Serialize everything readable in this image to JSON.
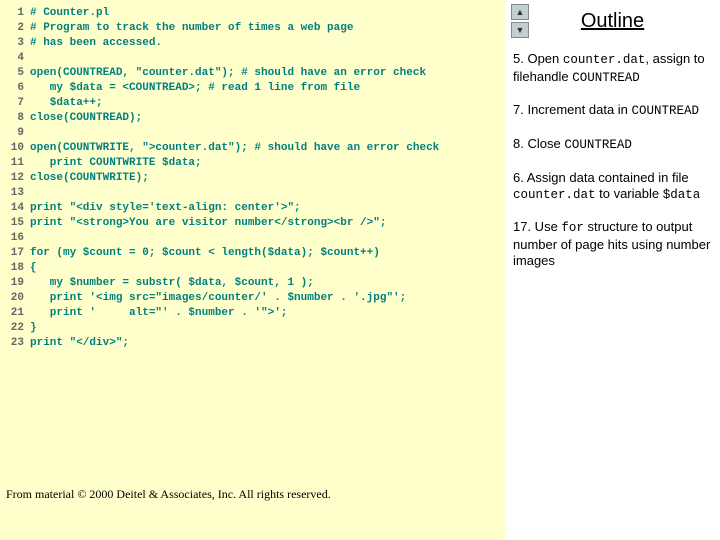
{
  "code": {
    "lines": [
      {
        "n": "1",
        "t": "# Counter.pl"
      },
      {
        "n": "2",
        "t": "# Program to track the number of times a web page"
      },
      {
        "n": "3",
        "t": "# has been accessed."
      },
      {
        "n": "4",
        "t": ""
      },
      {
        "n": "5",
        "t": "open(COUNTREAD, \"counter.dat\"); # should have an error check"
      },
      {
        "n": "6",
        "t": "   my $data = <COUNTREAD>; # read 1 line from file"
      },
      {
        "n": "7",
        "t": "   $data++;"
      },
      {
        "n": "8",
        "t": "close(COUNTREAD);"
      },
      {
        "n": "9",
        "t": ""
      },
      {
        "n": "10",
        "t": "open(COUNTWRITE, \">counter.dat\"); # should have an error check"
      },
      {
        "n": "11",
        "t": "   print COUNTWRITE $data;"
      },
      {
        "n": "12",
        "t": "close(COUNTWRITE);"
      },
      {
        "n": "13",
        "t": ""
      },
      {
        "n": "14",
        "t": "print \"<div style='text-align: center'>\";"
      },
      {
        "n": "15",
        "t": "print \"<strong>You are visitor number</strong><br />\";"
      },
      {
        "n": "16",
        "t": ""
      },
      {
        "n": "17",
        "t": "for (my $count = 0; $count < length($data); $count++)"
      },
      {
        "n": "18",
        "t": "{"
      },
      {
        "n": "19",
        "t": "   my $number = substr( $data, $count, 1 );"
      },
      {
        "n": "20",
        "t": "   print '<img src=\"images/counter/' . $number . '.jpg\"';"
      },
      {
        "n": "21",
        "t": "   print '     alt=\"' . $number . '\">';"
      },
      {
        "n": "22",
        "t": "}"
      },
      {
        "n": "23",
        "t": "print \"</div>\";"
      }
    ]
  },
  "footer": "From material © 2000 Deitel & Associates, Inc. All rights reserved.",
  "outline": {
    "title": "Outline",
    "nav_up": "▲",
    "nav_down": "▼",
    "n5a": "5. Open ",
    "n5b": "counter.dat",
    "n5c": ", assign to filehandle ",
    "n5d": "COUNTREAD",
    "n7a": "7. Increment data in ",
    "n7b": "COUNTREAD",
    "n8a": "8. Close ",
    "n8b": "COUNTREAD",
    "n6a": "6. Assign data contained in file ",
    "n6b": "counter.dat",
    "n6c": " to variable ",
    "n6d": "$data",
    "n17a": "17. Use ",
    "n17b": "for",
    "n17c": " structure to output number of page hits using number images"
  }
}
